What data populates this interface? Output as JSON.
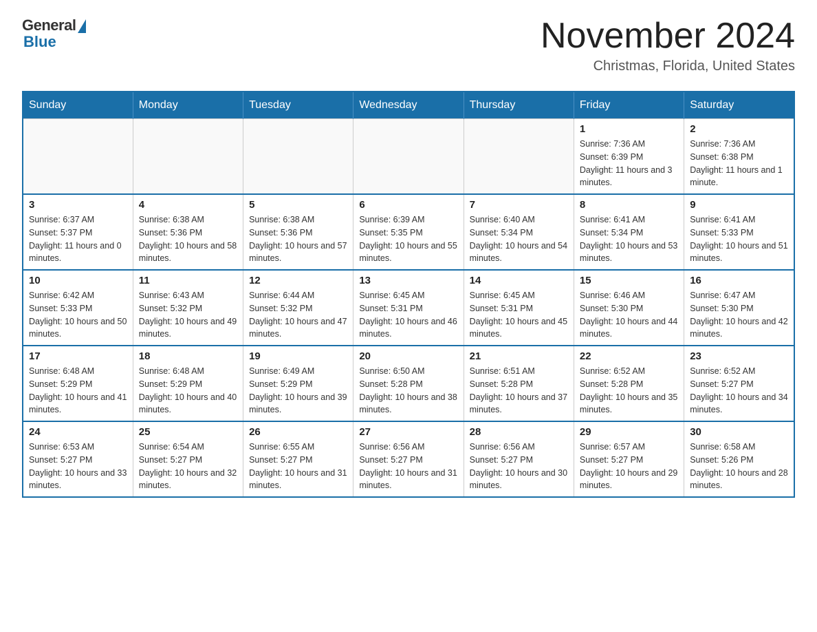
{
  "header": {
    "logo_general": "General",
    "logo_blue": "Blue",
    "month_year": "November 2024",
    "location": "Christmas, Florida, United States"
  },
  "weekdays": [
    "Sunday",
    "Monday",
    "Tuesday",
    "Wednesday",
    "Thursday",
    "Friday",
    "Saturday"
  ],
  "weeks": [
    [
      {
        "day": "",
        "info": ""
      },
      {
        "day": "",
        "info": ""
      },
      {
        "day": "",
        "info": ""
      },
      {
        "day": "",
        "info": ""
      },
      {
        "day": "",
        "info": ""
      },
      {
        "day": "1",
        "info": "Sunrise: 7:36 AM\nSunset: 6:39 PM\nDaylight: 11 hours and 3 minutes."
      },
      {
        "day": "2",
        "info": "Sunrise: 7:36 AM\nSunset: 6:38 PM\nDaylight: 11 hours and 1 minute."
      }
    ],
    [
      {
        "day": "3",
        "info": "Sunrise: 6:37 AM\nSunset: 5:37 PM\nDaylight: 11 hours and 0 minutes."
      },
      {
        "day": "4",
        "info": "Sunrise: 6:38 AM\nSunset: 5:36 PM\nDaylight: 10 hours and 58 minutes."
      },
      {
        "day": "5",
        "info": "Sunrise: 6:38 AM\nSunset: 5:36 PM\nDaylight: 10 hours and 57 minutes."
      },
      {
        "day": "6",
        "info": "Sunrise: 6:39 AM\nSunset: 5:35 PM\nDaylight: 10 hours and 55 minutes."
      },
      {
        "day": "7",
        "info": "Sunrise: 6:40 AM\nSunset: 5:34 PM\nDaylight: 10 hours and 54 minutes."
      },
      {
        "day": "8",
        "info": "Sunrise: 6:41 AM\nSunset: 5:34 PM\nDaylight: 10 hours and 53 minutes."
      },
      {
        "day": "9",
        "info": "Sunrise: 6:41 AM\nSunset: 5:33 PM\nDaylight: 10 hours and 51 minutes."
      }
    ],
    [
      {
        "day": "10",
        "info": "Sunrise: 6:42 AM\nSunset: 5:33 PM\nDaylight: 10 hours and 50 minutes."
      },
      {
        "day": "11",
        "info": "Sunrise: 6:43 AM\nSunset: 5:32 PM\nDaylight: 10 hours and 49 minutes."
      },
      {
        "day": "12",
        "info": "Sunrise: 6:44 AM\nSunset: 5:32 PM\nDaylight: 10 hours and 47 minutes."
      },
      {
        "day": "13",
        "info": "Sunrise: 6:45 AM\nSunset: 5:31 PM\nDaylight: 10 hours and 46 minutes."
      },
      {
        "day": "14",
        "info": "Sunrise: 6:45 AM\nSunset: 5:31 PM\nDaylight: 10 hours and 45 minutes."
      },
      {
        "day": "15",
        "info": "Sunrise: 6:46 AM\nSunset: 5:30 PM\nDaylight: 10 hours and 44 minutes."
      },
      {
        "day": "16",
        "info": "Sunrise: 6:47 AM\nSunset: 5:30 PM\nDaylight: 10 hours and 42 minutes."
      }
    ],
    [
      {
        "day": "17",
        "info": "Sunrise: 6:48 AM\nSunset: 5:29 PM\nDaylight: 10 hours and 41 minutes."
      },
      {
        "day": "18",
        "info": "Sunrise: 6:48 AM\nSunset: 5:29 PM\nDaylight: 10 hours and 40 minutes."
      },
      {
        "day": "19",
        "info": "Sunrise: 6:49 AM\nSunset: 5:29 PM\nDaylight: 10 hours and 39 minutes."
      },
      {
        "day": "20",
        "info": "Sunrise: 6:50 AM\nSunset: 5:28 PM\nDaylight: 10 hours and 38 minutes."
      },
      {
        "day": "21",
        "info": "Sunrise: 6:51 AM\nSunset: 5:28 PM\nDaylight: 10 hours and 37 minutes."
      },
      {
        "day": "22",
        "info": "Sunrise: 6:52 AM\nSunset: 5:28 PM\nDaylight: 10 hours and 35 minutes."
      },
      {
        "day": "23",
        "info": "Sunrise: 6:52 AM\nSunset: 5:27 PM\nDaylight: 10 hours and 34 minutes."
      }
    ],
    [
      {
        "day": "24",
        "info": "Sunrise: 6:53 AM\nSunset: 5:27 PM\nDaylight: 10 hours and 33 minutes."
      },
      {
        "day": "25",
        "info": "Sunrise: 6:54 AM\nSunset: 5:27 PM\nDaylight: 10 hours and 32 minutes."
      },
      {
        "day": "26",
        "info": "Sunrise: 6:55 AM\nSunset: 5:27 PM\nDaylight: 10 hours and 31 minutes."
      },
      {
        "day": "27",
        "info": "Sunrise: 6:56 AM\nSunset: 5:27 PM\nDaylight: 10 hours and 31 minutes."
      },
      {
        "day": "28",
        "info": "Sunrise: 6:56 AM\nSunset: 5:27 PM\nDaylight: 10 hours and 30 minutes."
      },
      {
        "day": "29",
        "info": "Sunrise: 6:57 AM\nSunset: 5:27 PM\nDaylight: 10 hours and 29 minutes."
      },
      {
        "day": "30",
        "info": "Sunrise: 6:58 AM\nSunset: 5:26 PM\nDaylight: 10 hours and 28 minutes."
      }
    ]
  ]
}
